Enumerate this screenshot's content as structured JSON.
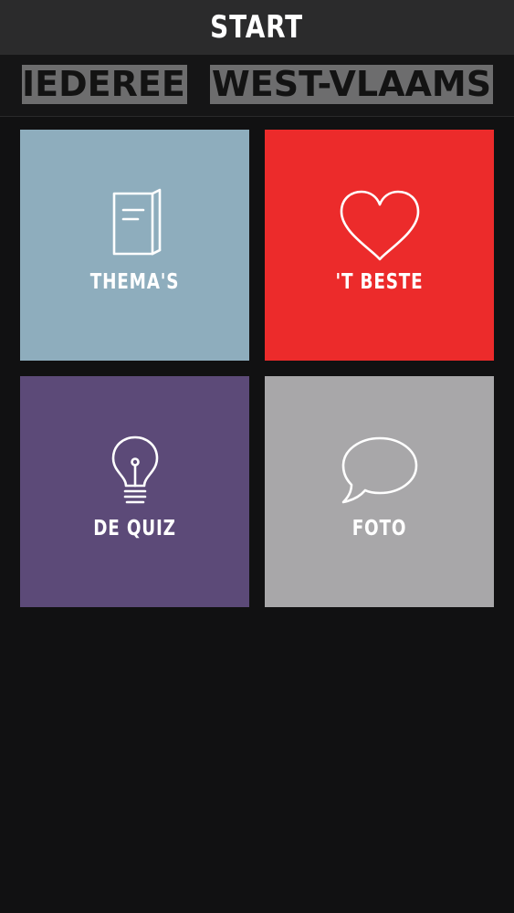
{
  "header": {
    "title": "START"
  },
  "logo": {
    "word_left": "IEDEREEN",
    "word_right": "WEST-VLAAMS"
  },
  "colors": {
    "themas": "#8eadbd",
    "beste": "#ec2b2b",
    "quiz": "#5c4a78",
    "foto": "#a8a7a9"
  },
  "tiles": [
    {
      "label": "THEMA'S",
      "icon": "book-icon"
    },
    {
      "label": "'T BESTE",
      "icon": "heart-icon"
    },
    {
      "label": "DE QUIZ",
      "icon": "lightbulb-icon"
    },
    {
      "label": "FOTO",
      "icon": "speech-bubble-icon"
    }
  ]
}
